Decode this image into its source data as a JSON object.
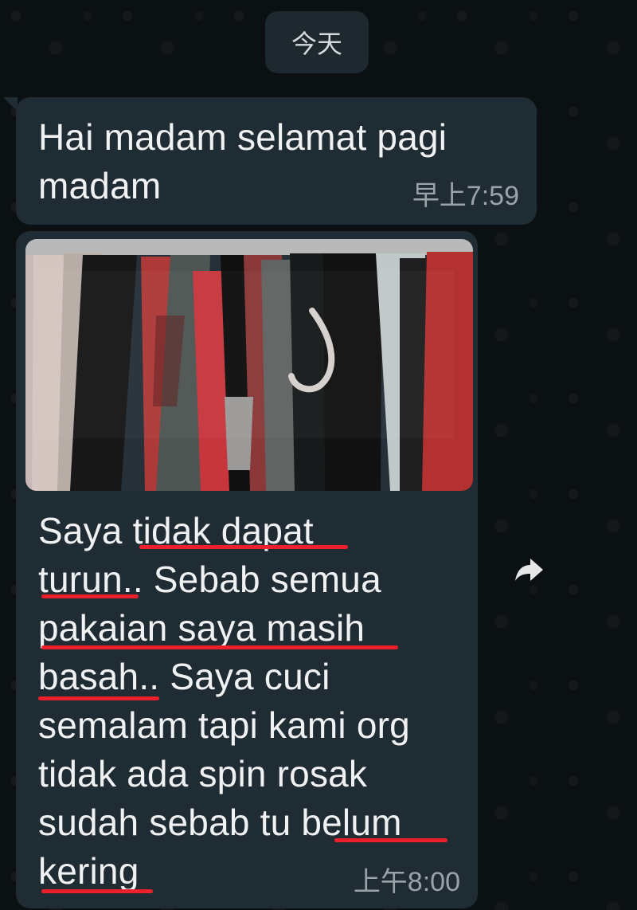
{
  "date_chip": "今天",
  "messages": [
    {
      "lines": [
        "Hai madam selamat pagi",
        "madam"
      ],
      "time": "早上7:59"
    },
    {
      "lines": [
        "Saya tidak dapat",
        "turun.. Sebab semua",
        "pakaian saya masih",
        "basah.. Saya cuci",
        "semalam tapi kami org",
        "tidak ada spin rosak",
        "sudah sebab tu belum",
        "kering"
      ],
      "time": "上午8:00"
    }
  ],
  "icons": {
    "forward": "forward-arrow-icon"
  },
  "colors": {
    "chat_background": "#0b1013",
    "bubble": "#1f2c34",
    "underline": "#ec1f2c",
    "text": "#f0f1f2",
    "timestamp": "#9aa3a8"
  }
}
